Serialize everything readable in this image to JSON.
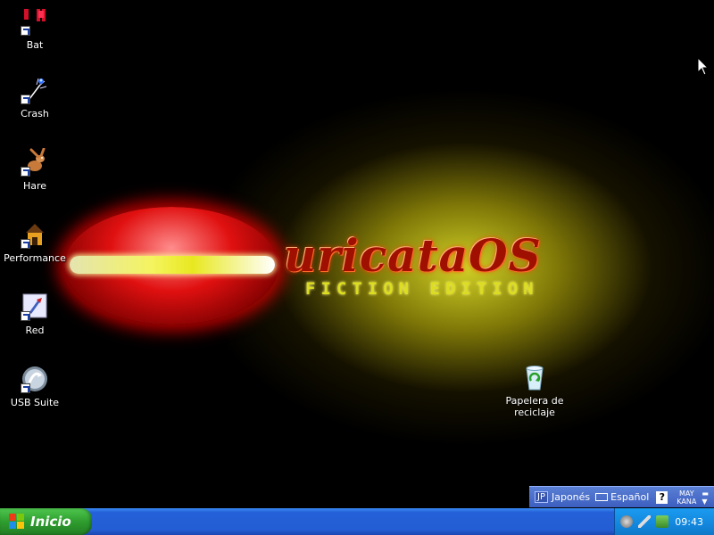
{
  "desktop_icons": [
    {
      "label": "Bat",
      "icon": "bat-icon"
    },
    {
      "label": "Crash",
      "icon": "crash-icon"
    },
    {
      "label": "Hare",
      "icon": "hare-icon"
    },
    {
      "label": "Performance",
      "icon": "performance-icon"
    },
    {
      "label": "Red",
      "icon": "red-icon"
    },
    {
      "label": "USB Suite",
      "icon": "usb-suite-icon"
    },
    {
      "label": "Papelera de reciclaje",
      "icon": "recycle-bin-icon"
    }
  ],
  "wallpaper": {
    "title": "uricataOS",
    "subtitle": "FICTION EDITION",
    "colors": {
      "red": "#e01010",
      "yellow": "#dcdc20",
      "bg": "#000000"
    }
  },
  "language_bar": {
    "lang_code": "JP",
    "lang_name": "Japonés",
    "keyboard": "Español",
    "help": "?",
    "caps": "MAY",
    "kana": "KANA"
  },
  "taskbar": {
    "start_label": "Inicio",
    "clock": "09:43",
    "colors": {
      "taskbar": "#245ed4",
      "start": "#2e9d2e",
      "tray": "#1287de"
    }
  }
}
